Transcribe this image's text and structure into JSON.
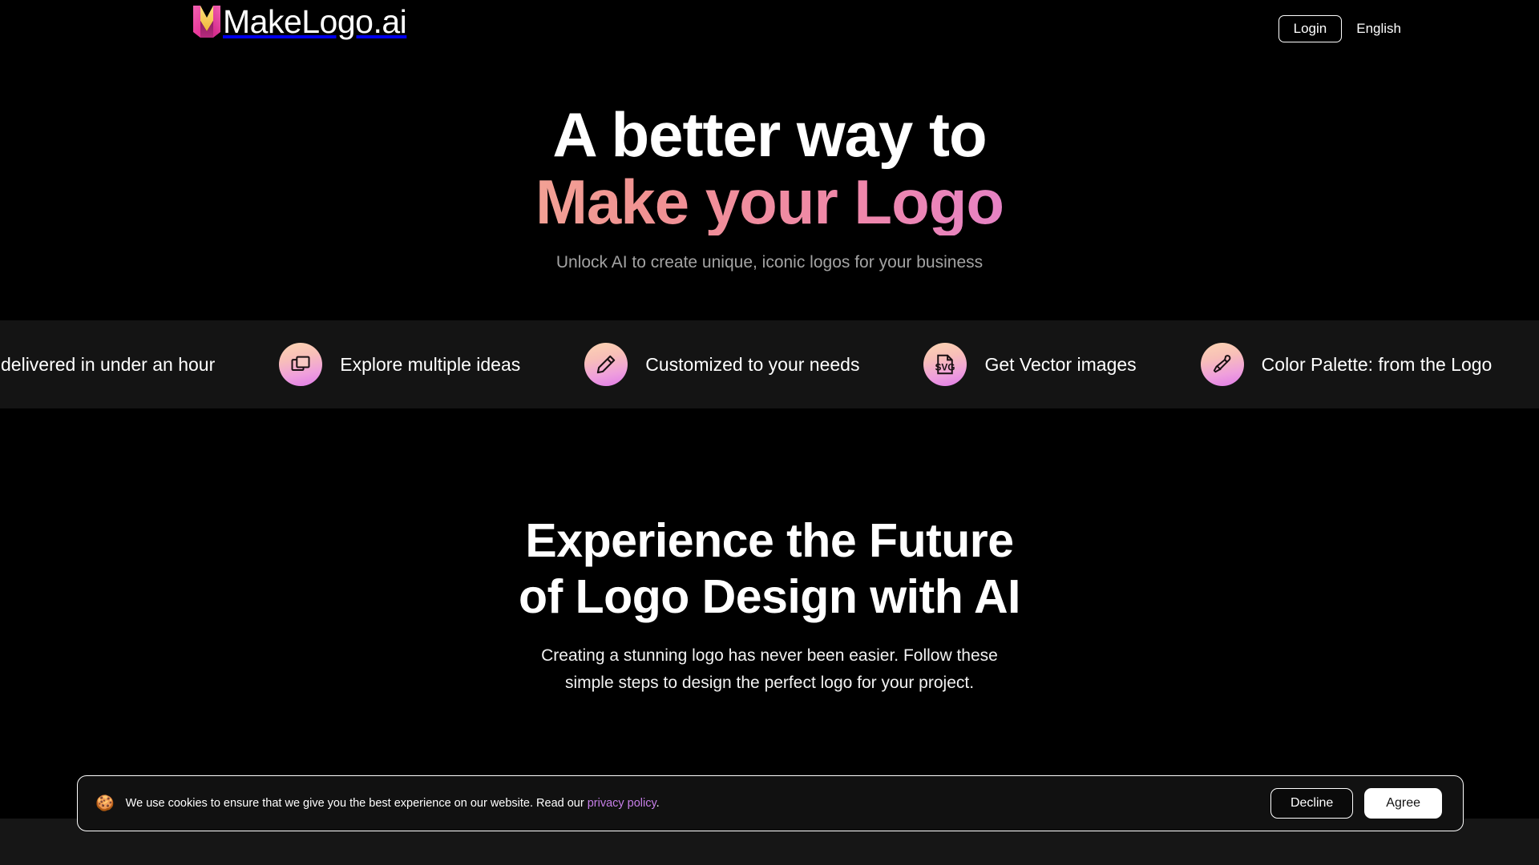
{
  "header": {
    "brand_name": "MakeLogo.ai",
    "brand_icon": "makelogo-m-mark-icon",
    "login_label": "Login",
    "language_label": "English"
  },
  "hero": {
    "headline_line1": "A better way to",
    "headline_line2": "Make your Logo",
    "subheadline": "Unlock AI to create unique, iconic logos for your business",
    "gradient_start": "#fbd0a3",
    "gradient_mid": "#f09292",
    "gradient_end": "#cb79f2"
  },
  "ticker": {
    "background": "#141414",
    "items": [
      {
        "label": "delivered in under an hour",
        "icon": "clock-icon",
        "partial": true
      },
      {
        "label": "Explore multiple ideas",
        "icon": "layers-copy-icon"
      },
      {
        "label": "Customized to your needs",
        "icon": "pencil-edit-icon"
      },
      {
        "label": "Get Vector images",
        "icon": "svg-file-icon"
      },
      {
        "label": "Color Palette: from the Logo",
        "icon": "eyedropper-icon"
      },
      {
        "label": "",
        "icon": "letter-a-font-icon",
        "partial": true
      }
    ]
  },
  "section2": {
    "heading_line1": "Experience the Future",
    "heading_line2": "of Logo Design with AI",
    "paragraph_line1": "Creating a stunning logo has never been easier. Follow these",
    "paragraph_line2": "simple steps to design the perfect logo for your project."
  },
  "cookie_banner": {
    "emoji": "🍪",
    "text_before_link": "We use cookies to ensure that we give you the best experience on our website. Read our ",
    "link_label": "privacy policy",
    "text_after_link": ".",
    "link_color": "#c77fe8",
    "decline_label": "Decline",
    "agree_label": "Agree"
  }
}
